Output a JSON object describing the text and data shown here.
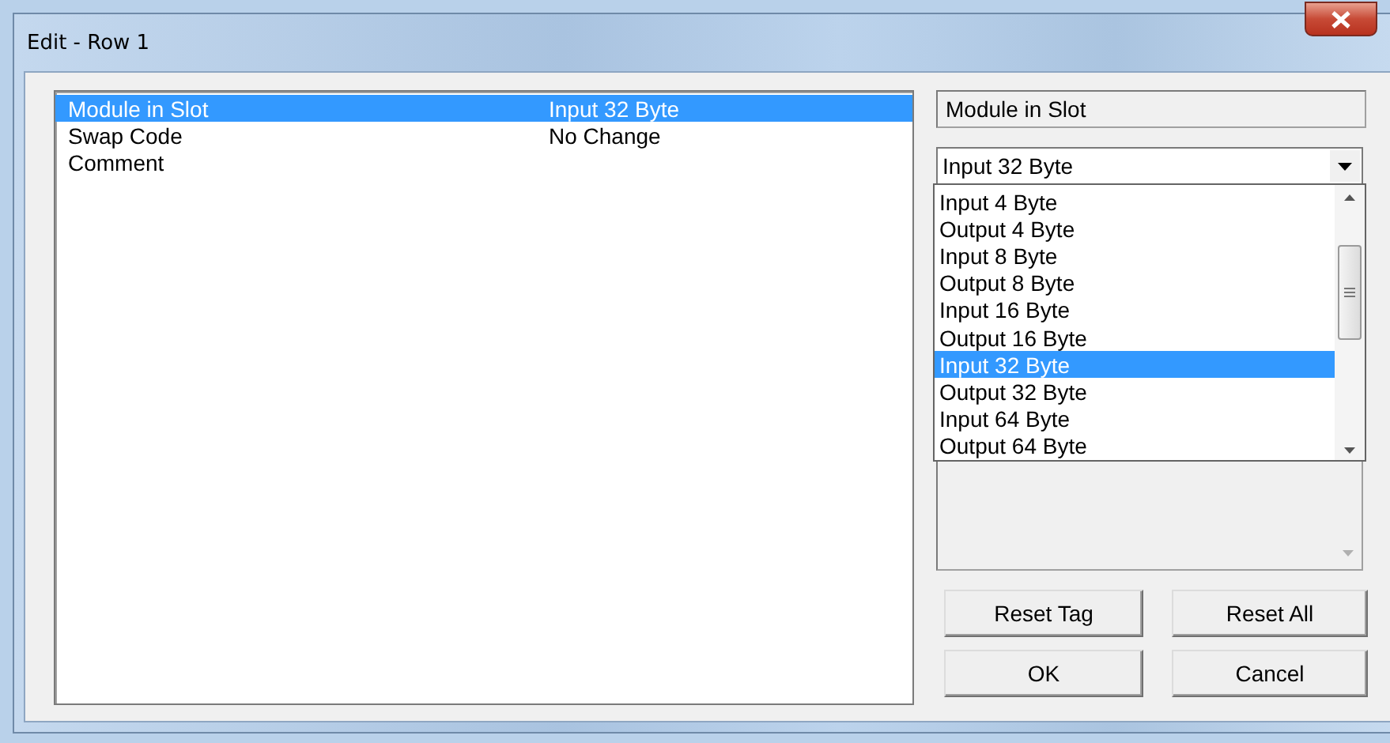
{
  "window": {
    "title": "Edit - Row 1"
  },
  "rows": [
    {
      "name": "Module in Slot",
      "value": "Input 32 Byte",
      "selected": true
    },
    {
      "name": "Swap Code",
      "value": "No Change",
      "selected": false
    },
    {
      "name": "Comment",
      "selected": false
    }
  ],
  "field_label": "Module in Slot",
  "combo": {
    "value": "Input 32 Byte",
    "expanded": true,
    "options": [
      {
        "label": "Input 4 Byte",
        "selected": false
      },
      {
        "label": "Output 4 Byte",
        "selected": false
      },
      {
        "label": "Input 8 Byte",
        "selected": false
      },
      {
        "label": "Output 8 Byte",
        "selected": false
      },
      {
        "label": "Input 16 Byte",
        "selected": false
      },
      {
        "label": "Output 16 Byte",
        "selected": false
      },
      {
        "label": "Input 32 Byte",
        "selected": true
      },
      {
        "label": "Output 32 Byte",
        "selected": false
      },
      {
        "label": "Input 64 Byte",
        "selected": false
      },
      {
        "label": "Output 64 Byte",
        "selected": false
      }
    ]
  },
  "buttons": [
    {
      "label": "Reset Tag"
    },
    {
      "label": "Reset All"
    },
    {
      "label": "OK"
    },
    {
      "label": "Cancel"
    }
  ]
}
